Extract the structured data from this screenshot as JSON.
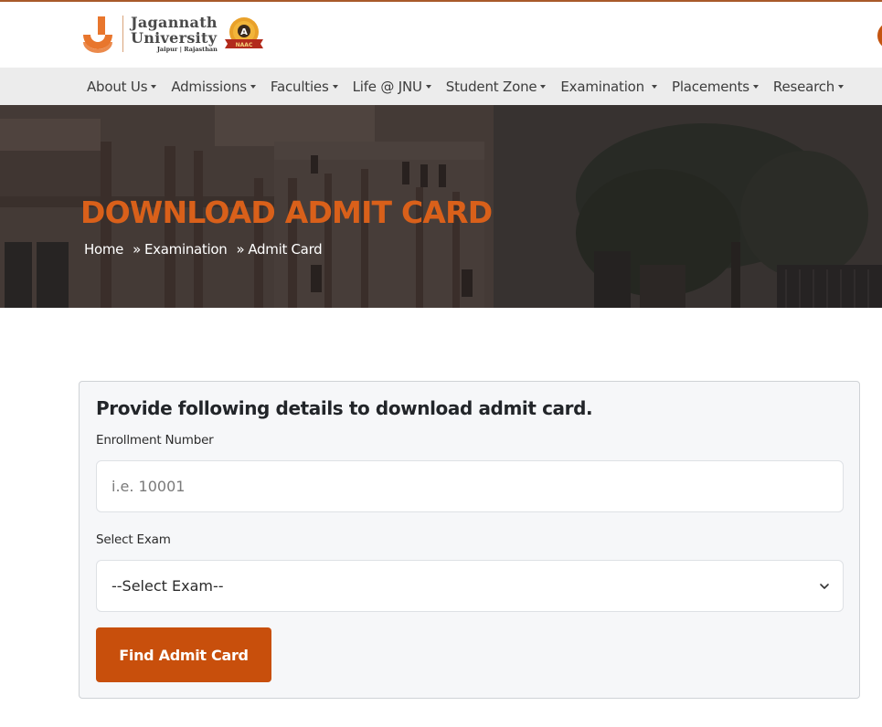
{
  "header": {
    "logo": {
      "name_line1": "Jagannath",
      "name_line2": "University",
      "location": "Jaipur | Rajasthan",
      "badge_grade": "A",
      "badge_label": "NAAC"
    },
    "brand_color": "#c84f0c"
  },
  "nav": {
    "items": [
      {
        "label": "About Us",
        "has_dropdown": true
      },
      {
        "label": "Admissions",
        "has_dropdown": true
      },
      {
        "label": "Faculties",
        "has_dropdown": true
      },
      {
        "label": "Life @ JNU",
        "has_dropdown": true
      },
      {
        "label": "Student Zone",
        "has_dropdown": true
      },
      {
        "label": "Examination",
        "has_dropdown": true
      },
      {
        "label": "Placements",
        "has_dropdown": true
      },
      {
        "label": "Research",
        "has_dropdown": true
      }
    ]
  },
  "hero": {
    "title": "DOWNLOAD ADMIT CARD",
    "breadcrumb": [
      {
        "label": "Home"
      },
      {
        "label": "Examination"
      },
      {
        "label": "Admit Card"
      }
    ],
    "separator": "»"
  },
  "form": {
    "title": "Provide following details to download admit card.",
    "enrollment": {
      "label": "Enrollment Number",
      "placeholder": "i.e. 10001",
      "value": ""
    },
    "exam": {
      "label": "Select Exam",
      "selected": "--Select Exam--"
    },
    "submit_label": "Find Admit Card"
  }
}
